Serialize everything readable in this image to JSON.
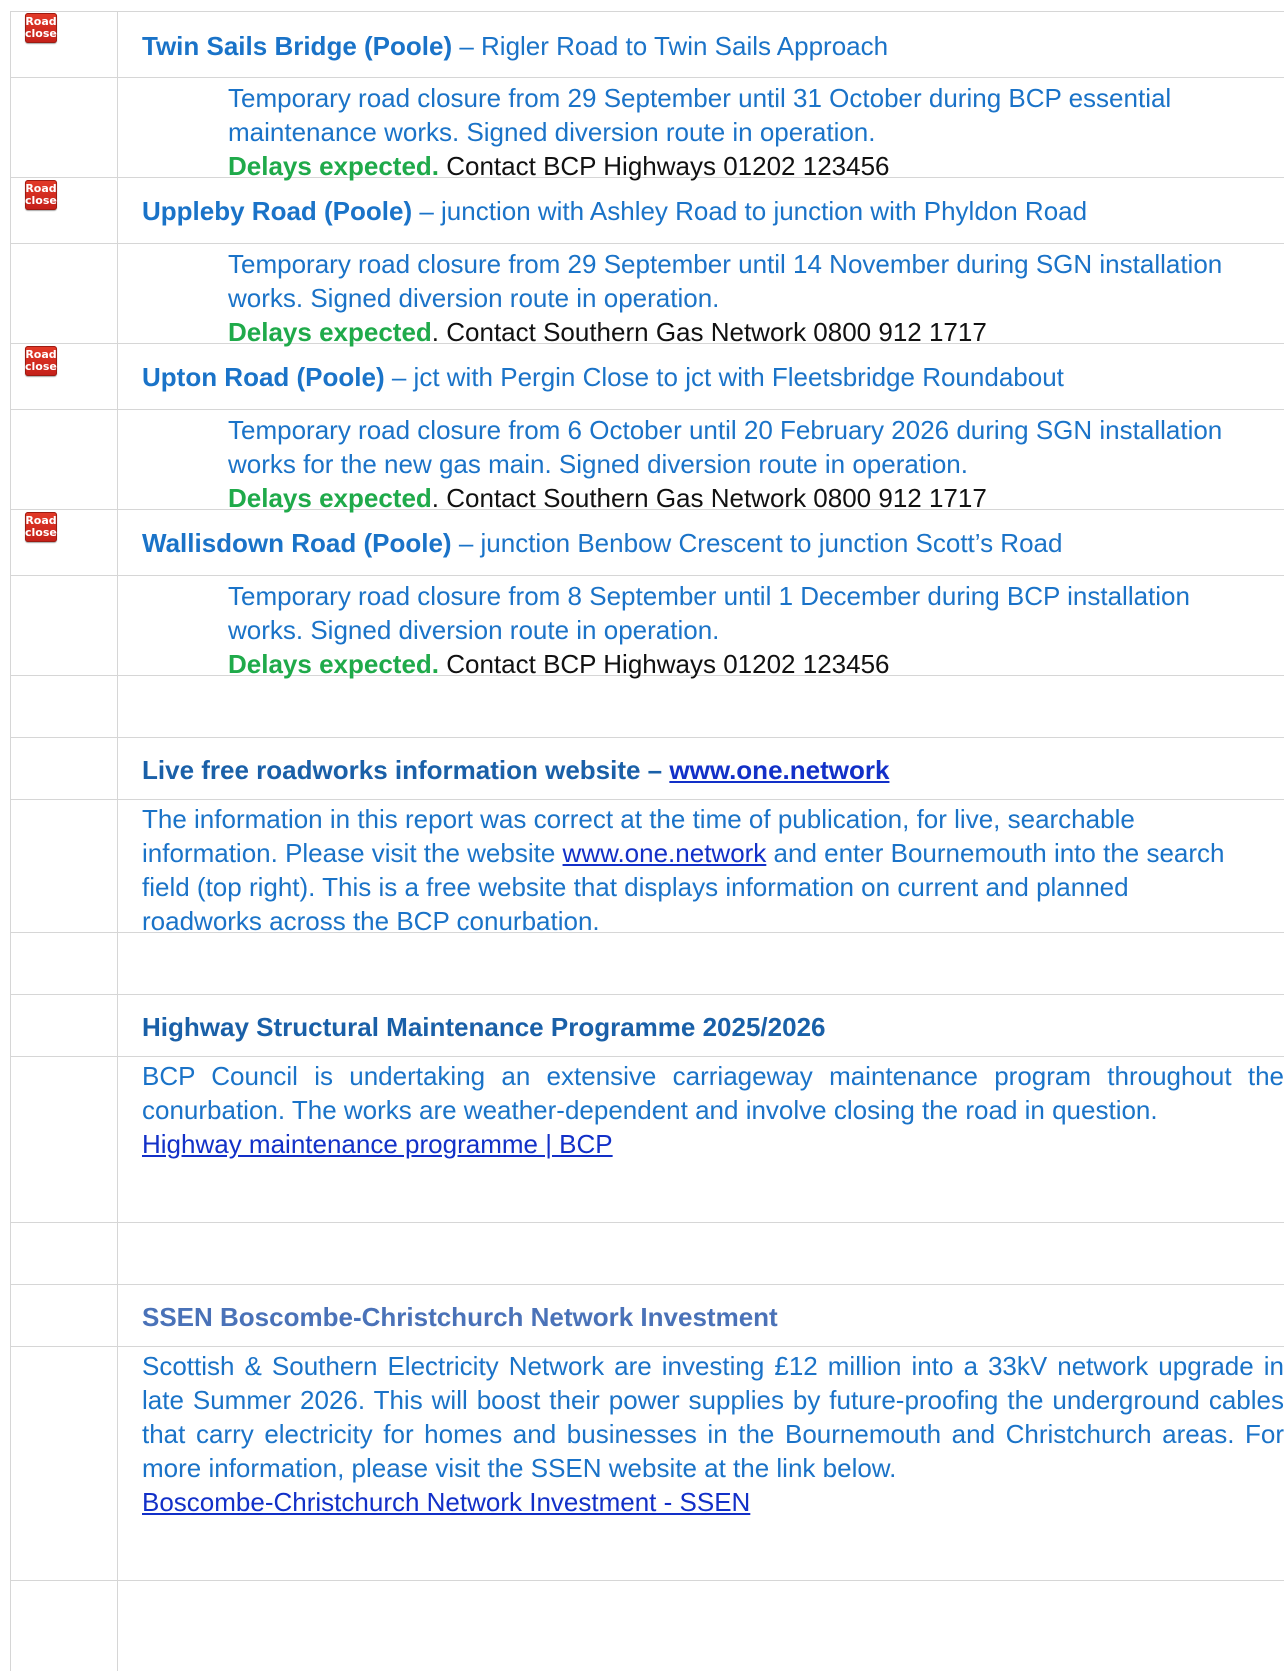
{
  "closures": [
    {
      "sign": [
        "Road",
        "closed"
      ],
      "road": "Twin Sails Bridge (Poole)",
      "extent": " – Rigler Road to Twin Sails Approach",
      "text": "Temporary road closure from 29 September until 31 October during BCP essential maintenance works. Signed diversion route in operation.",
      "delays": "Delays expected.",
      "contact": " Contact BCP Highways 01202 123456"
    },
    {
      "sign": [
        "Road",
        "closed"
      ],
      "road": "Uppleby Road (Poole)",
      "extent": " – junction with Ashley Road to junction with Phyldon Road",
      "text": "Temporary road closure from 29 September until 14 November during SGN installation works. Signed diversion route in operation.",
      "delays": "Delays expected",
      "contact": ". Contact Southern Gas Network 0800 912 1717"
    },
    {
      "sign": [
        "Road",
        "closed"
      ],
      "road": "Upton Road (Poole)",
      "extent": " – jct with Pergin Close to jct with Fleetsbridge Roundabout",
      "text": "Temporary road closure from 6 October until 20 February 2026 during SGN installation works for the new gas main. Signed diversion route in operation.",
      "delays": "Delays expected",
      "contact": ". Contact Southern Gas Network 0800 912 1717"
    },
    {
      "sign": [
        "Road",
        "closed"
      ],
      "road": "Wallisdown Road (Poole)",
      "extent": " – junction Benbow Crescent to junction Scott’s Road",
      "text": "Temporary road closure from 8 September until 1 December during BCP installation works. Signed diversion route in operation.",
      "delays": "Delays expected.",
      "contact": " Contact BCP Highways 01202 123456"
    }
  ],
  "live": {
    "title": "Live free roadworks information website – ",
    "title_link": "www.one.network",
    "text_before": "The information in this report was correct at the time of publication, for live, searchable information. Please visit the website ",
    "text_link": "www.one.network",
    "text_after": " and enter Bournemouth into the search field (top right). This is a free website that displays information on current and planned roadworks across the BCP conurbation."
  },
  "maintenance": {
    "title": "Highway Structural Maintenance Programme 2025/2026",
    "text": "BCP Council is undertaking an extensive carriageway maintenance program throughout the conurbation. The works are weather-dependent and involve closing the road in question.",
    "link": "Highway maintenance programme | BCP"
  },
  "ssen": {
    "title": "SSEN Boscombe-Christchurch Network Investment",
    "text": "Scottish & Southern Electricity Network are investing £12 million into a 33kV network upgrade in late Summer 2026. This will boost their power supplies by future-proofing the underground cables that carry electricity for homes and businesses in the Bournemouth and Christchurch areas. For more information, please visit the SSEN website at the link below.",
    "link": "Boscombe-Christchurch Network Investment - SSEN"
  }
}
